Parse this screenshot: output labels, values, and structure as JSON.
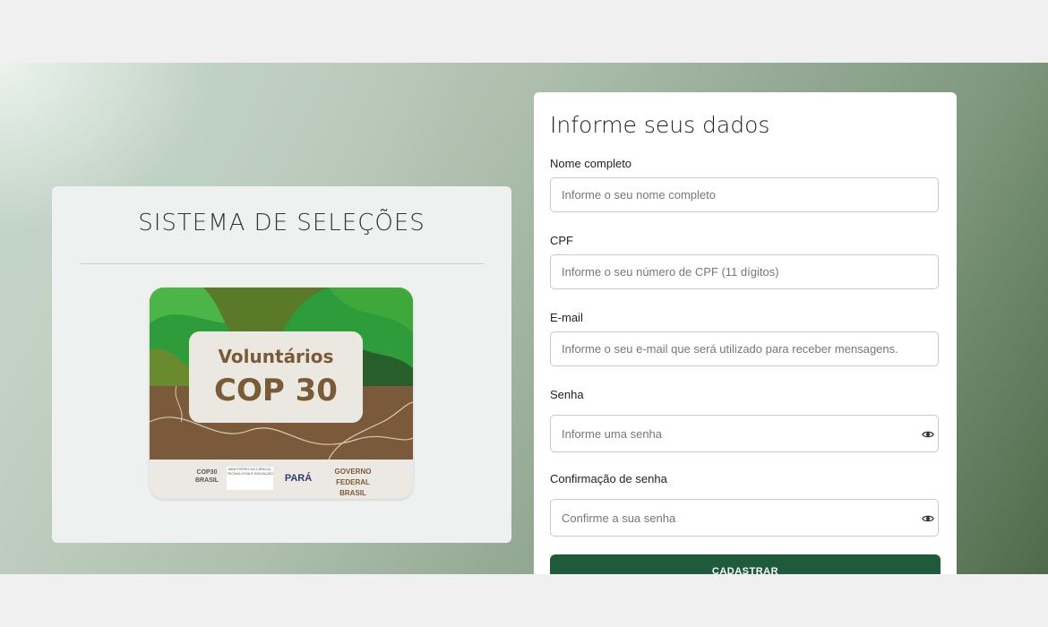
{
  "left_panel": {
    "title": "SISTEMA DE SELEÇÕES",
    "banner": {
      "line1": "Voluntários",
      "line2": "COP 30",
      "logos": [
        "COP30 BRASIL",
        "MINISTÉRIO DA CIÊNCIA, TECNOLOGIA E INOVAÇÃO",
        "PARÁ",
        "GOVERNO FEDERAL BRASIL"
      ]
    }
  },
  "form": {
    "title": "Informe seus dados",
    "fields": [
      {
        "label": "Nome completo",
        "placeholder": "Informe o seu nome completo",
        "value": ""
      },
      {
        "label": "CPF",
        "placeholder": "Informe o seu número de CPF (11 dígitos)",
        "value": ""
      },
      {
        "label": "E-mail",
        "placeholder": "Informe o seu e-mail que será utilizado para receber mensagens.",
        "value": ""
      },
      {
        "label": "Senha",
        "placeholder": "Informe uma senha",
        "value": "",
        "icon": "eye-icon"
      },
      {
        "label": "Confirmação de senha",
        "placeholder": "Confirme a sua senha",
        "value": "",
        "icon": "eye-icon"
      }
    ],
    "submit_label": "CADASTRAR"
  },
  "colors": {
    "primary_button": "#1f5a3c",
    "banner_green": "#2e9e3a",
    "banner_brown": "#7a5b37"
  }
}
